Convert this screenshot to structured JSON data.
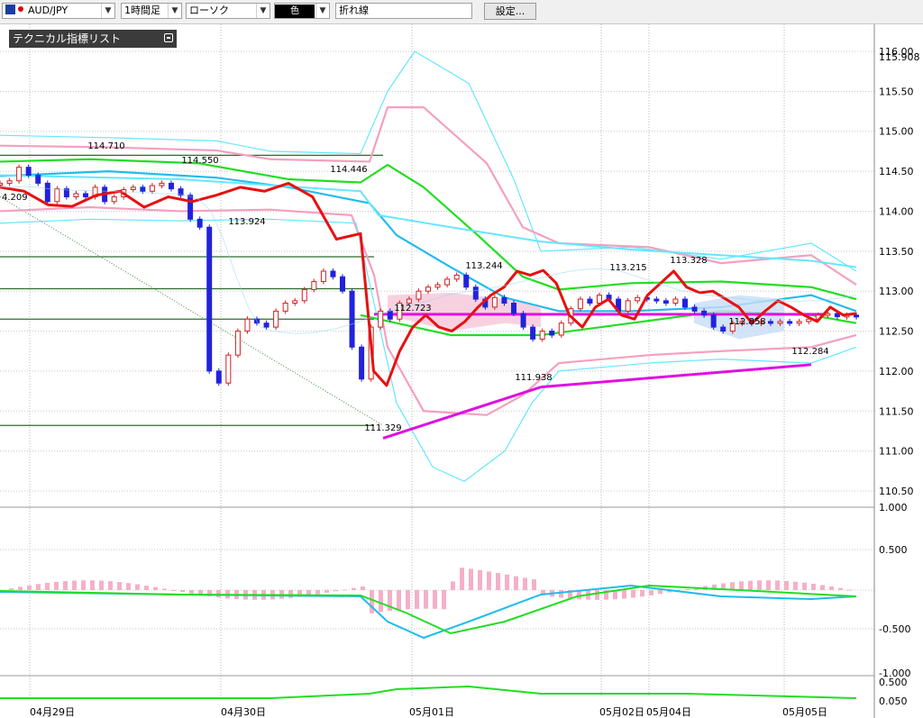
{
  "toolbar": {
    "pair": "AUD/JPY",
    "timeframe": "1時間足",
    "chart_style": "ローソク",
    "color_label": "色",
    "tool": "折れ線",
    "settings_label": "設定..."
  },
  "indicator_panel": {
    "title": "テクニカル指標リスト"
  },
  "colors": {
    "price_line": "#e81010",
    "bb_outer": "#66e6ff",
    "bb_inner": "#f4a0c0",
    "ma_green": "#22dd22",
    "ma_cyan": "#22bbee",
    "trend": "#e010e0",
    "hline": "#2e6b2e"
  },
  "chart_data": {
    "type": "line",
    "x": [
      "04月29日",
      "04月30日",
      "05月01日",
      "05月02日",
      "05月04日",
      "05月05日"
    ],
    "price_axis": {
      "ticks": [
        "116.00",
        "115.50",
        "115.00",
        "114.50",
        "114.00",
        "113.50",
        "113.00",
        "112.50",
        "112.00",
        "111.50",
        "111.00",
        "110.50"
      ],
      "current": "115.908"
    },
    "osc_axis": {
      "ticks": [
        "1.000",
        "0.500",
        "-0.500",
        "-1.000"
      ]
    },
    "sub_axis": {
      "ticks": [
        "0.500",
        "0.050"
      ]
    },
    "annotations": [
      "114.710",
      "114.550",
      "114.446",
      "4.209",
      "113.924",
      "113.244",
      "113.215",
      "113.328",
      "112.723",
      "112.858",
      "111.938",
      "112.284",
      "111.329"
    ],
    "series": [
      {
        "values": [
          114.35,
          114.38,
          114.55,
          114.45,
          114.35,
          114.12,
          114.28,
          114.18,
          114.22,
          114.18,
          114.3,
          114.12,
          114.18,
          114.27,
          114.3,
          114.25,
          114.32,
          114.35,
          114.28,
          114.2,
          113.9,
          113.8,
          112.0,
          111.85,
          112.2,
          112.5,
          112.65,
          112.6,
          112.55,
          112.75,
          112.85,
          112.88,
          113.02,
          113.12,
          113.25,
          113.18,
          113.0,
          112.3,
          111.9,
          112.55,
          112.75,
          112.65,
          112.85,
          112.9,
          113.0,
          113.05,
          113.08,
          113.15,
          113.2,
          113.05,
          112.9,
          112.8,
          112.92,
          112.85,
          112.72,
          112.55,
          112.4,
          112.5,
          112.45,
          112.6,
          112.78,
          112.9,
          112.85,
          112.95,
          112.9,
          112.75,
          112.88,
          112.92,
          112.9,
          112.88,
          112.85,
          112.9,
          112.8,
          112.75,
          112.7,
          112.55,
          112.5,
          112.6,
          112.62,
          112.6,
          112.62,
          112.6,
          112.62,
          112.6,
          112.62,
          112.65,
          112.7,
          112.72,
          112.68,
          112.7,
          112.68
        ]
      },
      {
        "values": [
          114.3,
          114.3,
          114.31,
          114.3,
          114.28,
          114.27,
          114.26,
          114.26,
          114.25,
          114.25,
          114.24,
          114.24,
          114.23,
          114.22,
          114.22,
          114.2,
          114.15,
          114.0,
          113.65,
          113.2,
          112.8,
          112.55,
          112.5,
          112.48,
          112.47,
          112.48,
          112.5,
          112.53,
          112.57,
          112.62,
          112.68,
          112.73,
          112.78,
          112.82,
          112.86,
          112.9,
          112.95,
          112.98,
          113.0,
          113.02,
          113.05,
          113.08,
          113.12,
          113.15,
          113.18,
          113.22,
          113.25,
          113.27,
          113.28,
          113.27,
          113.25,
          113.2,
          113.15,
          113.1,
          113.05,
          113.0,
          112.98,
          112.95,
          112.93,
          112.92,
          112.9,
          112.88,
          112.88,
          112.87,
          112.87,
          112.88,
          112.88,
          112.9,
          112.92,
          112.95
        ]
      }
    ]
  }
}
